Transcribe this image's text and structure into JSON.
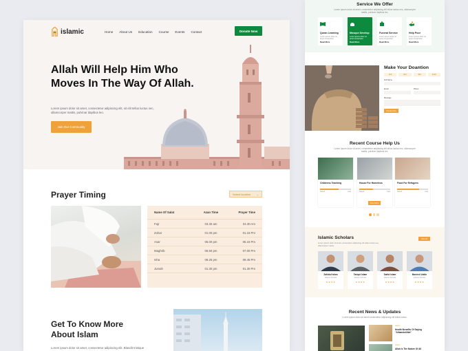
{
  "left": {
    "logo": {
      "name": "islamic",
      "icon": "mosque-logo-icon"
    },
    "nav": [
      "Home",
      "About Us",
      "Education",
      "Course",
      "Events",
      "Contact"
    ],
    "donate_label": "Donate Now",
    "hero": {
      "title": "Allah Will Help Him Who Moves In The Way Of Allah.",
      "desc": "Lorem ipsum dolor sit amet, consectetur adipiscing elit, sit elit tellus luctus nec, ullamcorper mattis, pulvinar dapibus leo.",
      "cta": "Join Our Community"
    },
    "prayer": {
      "title": "Prayer Timing",
      "select_label": "Select location",
      "headers": [
        "Name Of Salat",
        "Azan Time",
        "Prayer Time"
      ],
      "rows": [
        [
          "Fajr",
          "03.30 am",
          "04.30 Am"
        ],
        [
          "Zohar",
          "01.00 pm",
          "01.15 Pm"
        ],
        [
          "Asar",
          "05.00 pm",
          "05.15 Pm"
        ],
        [
          "Maghrib",
          "06.50 pm",
          "07.00 Pm"
        ],
        [
          "Isha",
          "08.25 pm",
          "08.45 Pm"
        ],
        [
          "Jumah",
          "01.30 pm",
          "01.30 Pm"
        ]
      ]
    },
    "about": {
      "title": "Get To Know More About Islam",
      "desc": "Lorem ipsum dolor sit amet, consectetur adipiscing elit. Blandit tristique"
    }
  },
  "right": {
    "services": {
      "title": "Service We Offer",
      "subtitle": "Lorem ipsum dolor sit amet, consectetur adipiscing elit tellus luctus nec, ullamcorper mattis, pulvinar dapibus leo.",
      "items": [
        {
          "title": "Quran Learning",
          "desc": "Lorem ipsum dolor sit amet consectetur",
          "more": "Read More",
          "icon": "book-icon"
        },
        {
          "title": "Mosque Develop",
          "desc": "Lorem ipsum dolor sit amet consectetur",
          "more": "Read More",
          "icon": "mosque-icon"
        },
        {
          "title": "Funeral Service",
          "desc": "Lorem ipsum dolor sit amet consectetur",
          "more": "Read More",
          "icon": "funeral-icon"
        },
        {
          "title": "Help Poor",
          "desc": "Lorem ipsum dolor sit amet consectetur",
          "more": "Read More",
          "icon": "hand-icon"
        }
      ]
    },
    "donation": {
      "title": "Make Your Doantion",
      "amounts": [
        "$10",
        "$20",
        "$50",
        "$100"
      ],
      "fields": [
        "Full Name",
        "Email",
        "Phone",
        "Message"
      ],
      "button": "Donate Now"
    },
    "courses": {
      "title": "Recent Course Help Us",
      "subtitle": "Lorem ipsum dolor sit amet, consectetur adipiscing elit tellus luctus nec, ullamcorper mattis, pulvinar dapibus leo.",
      "items": [
        {
          "title": "Childrens Teaching",
          "progress": 0.6
        },
        {
          "title": "House For Homeless",
          "progress": 0.45
        },
        {
          "title": "Food For Refugees",
          "progress": 0.7
        }
      ],
      "raised": "Raised",
      "goal": "Goal",
      "donate_label": "Donate Now",
      "more_label": "View More",
      "page_count": 3,
      "active_page": 1
    },
    "scholars": {
      "title": "Islamic Scholars",
      "desc": "Lorem ipsum dolor sit amet, consectetur adipiscing elit tellus luctus nec, ullamcorper mattis.",
      "button": "View All",
      "items": [
        {
          "name": "Zahidul Islam",
          "role": "Islamic Scholar",
          "rating": "★★★★"
        },
        {
          "name": "Tariqul Islam",
          "role": "Islamic Scholar",
          "rating": "★★★★"
        },
        {
          "name": "Saiful Islam",
          "role": "Islamic Scholar",
          "rating": "★★★★"
        },
        {
          "name": "Monirul Uddin",
          "role": "Islamic Scholar",
          "rating": "★★★★"
        }
      ]
    },
    "news": {
      "title": "Recent News & Updates",
      "subtitle": "Lorem ipsum dolor sit amet consectetur adipiscing elit tellus luctus.",
      "items": [
        {
          "tag": "Islamic",
          "title": "Health Benefits Of Saying \"Alhamdulillah\""
        },
        {
          "tag": "Islamic",
          "title": "Allah Is The Nature Of All"
        }
      ]
    }
  },
  "colors": {
    "primary_green": "#0e8a3f",
    "accent_orange": "#f0a23a",
    "hero_bg": "#f7f4f1",
    "table_bg": "#fbece0",
    "services_bg": "#f1f7f3",
    "scholars_bg": "#fbf6ee"
  }
}
